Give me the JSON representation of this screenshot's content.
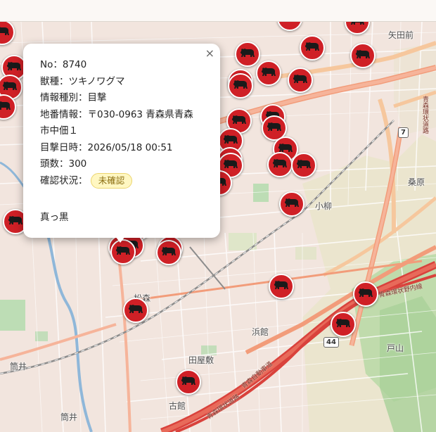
{
  "map": {
    "places": [
      {
        "id": "yatamae",
        "text": "矢田前"
      },
      {
        "id": "kuwabara",
        "text": "桑原"
      },
      {
        "id": "koyanagi",
        "text": "小柳"
      },
      {
        "id": "hamadate",
        "text": "浜館"
      },
      {
        "id": "tayashiki",
        "text": "田屋敷"
      },
      {
        "id": "toyama",
        "text": "戸山"
      },
      {
        "id": "tsutsui1",
        "text": "筒井"
      },
      {
        "id": "tsutsui2",
        "text": "筒井"
      },
      {
        "id": "furudate",
        "text": "古館"
      },
      {
        "id": "matsumori",
        "text": "松森"
      }
    ],
    "roads": [
      {
        "id": "r1",
        "text": "青森環状道路"
      },
      {
        "id": "r2",
        "text": "青森自動車道"
      },
      {
        "id": "r3",
        "text": "青森環状野内線"
      },
      {
        "id": "r4",
        "text": "青森環状道路"
      }
    ],
    "route_shields": [
      {
        "id": "s7",
        "text": "7"
      },
      {
        "id": "s44",
        "text": "44"
      }
    ],
    "marker_count": 37,
    "marker_color": "#cf2026",
    "marker_icon": "bear-icon"
  },
  "popup": {
    "no": "No：8740",
    "species": "獣種：ツキノワグマ",
    "type": "情報種別：目撃",
    "address_line1": "地番情報：〒030-0963 青森県青森",
    "address_line2": "市中佃１",
    "datetime": "目撃日時：2026/05/18 00:51",
    "count": "頭数：300",
    "status_label": "確認状況：",
    "status_badge": "未確認",
    "memo": "真っ黒",
    "close_symbol": "×"
  }
}
